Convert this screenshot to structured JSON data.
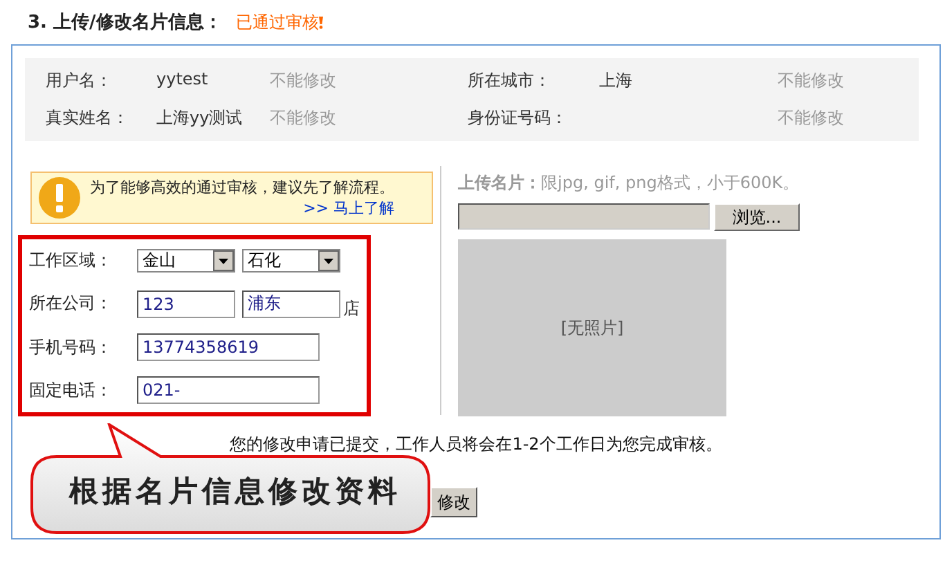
{
  "heading": {
    "title": "3. 上传/修改名片信息：",
    "status": "已通过审核"
  },
  "info": [
    {
      "label": "用户名：",
      "value": "yytest",
      "note": "不能修改"
    },
    {
      "label": "所在城市：",
      "value": "上海",
      "note": "不能修改"
    },
    {
      "label": "真实姓名：",
      "value": "上海yy测试",
      "note": "不能修改"
    },
    {
      "label": "身份证号码：",
      "note": "不能修改"
    }
  ],
  "notice": {
    "text": "为了能够高效的通过审核，建议先了解流程。",
    "link": ">> 马上了解"
  },
  "form": [
    {
      "label": "工作区域：",
      "kind": "selects",
      "values": [
        "金山",
        "石化"
      ]
    },
    {
      "label": "所在公司：",
      "kind": "inputs",
      "values": [
        "123",
        "浦东"
      ],
      "suffix": "店"
    },
    {
      "label": "手机号码：",
      "kind": "input",
      "values": [
        "13774358619"
      ]
    },
    {
      "label": "固定电话：",
      "kind": "input",
      "values": [
        "021-"
      ]
    }
  ],
  "upload": {
    "label": "上传名片：",
    "hint": "限jpg, gif, png格式，小于600K。",
    "browse": "浏览...",
    "photo_placeholder": "[无照片]"
  },
  "message": "您的修改申请已提交，工作人员将会在1-2个工作日为您完成审核。",
  "submit": "修改",
  "callout": "根据名片信息修改资料"
}
